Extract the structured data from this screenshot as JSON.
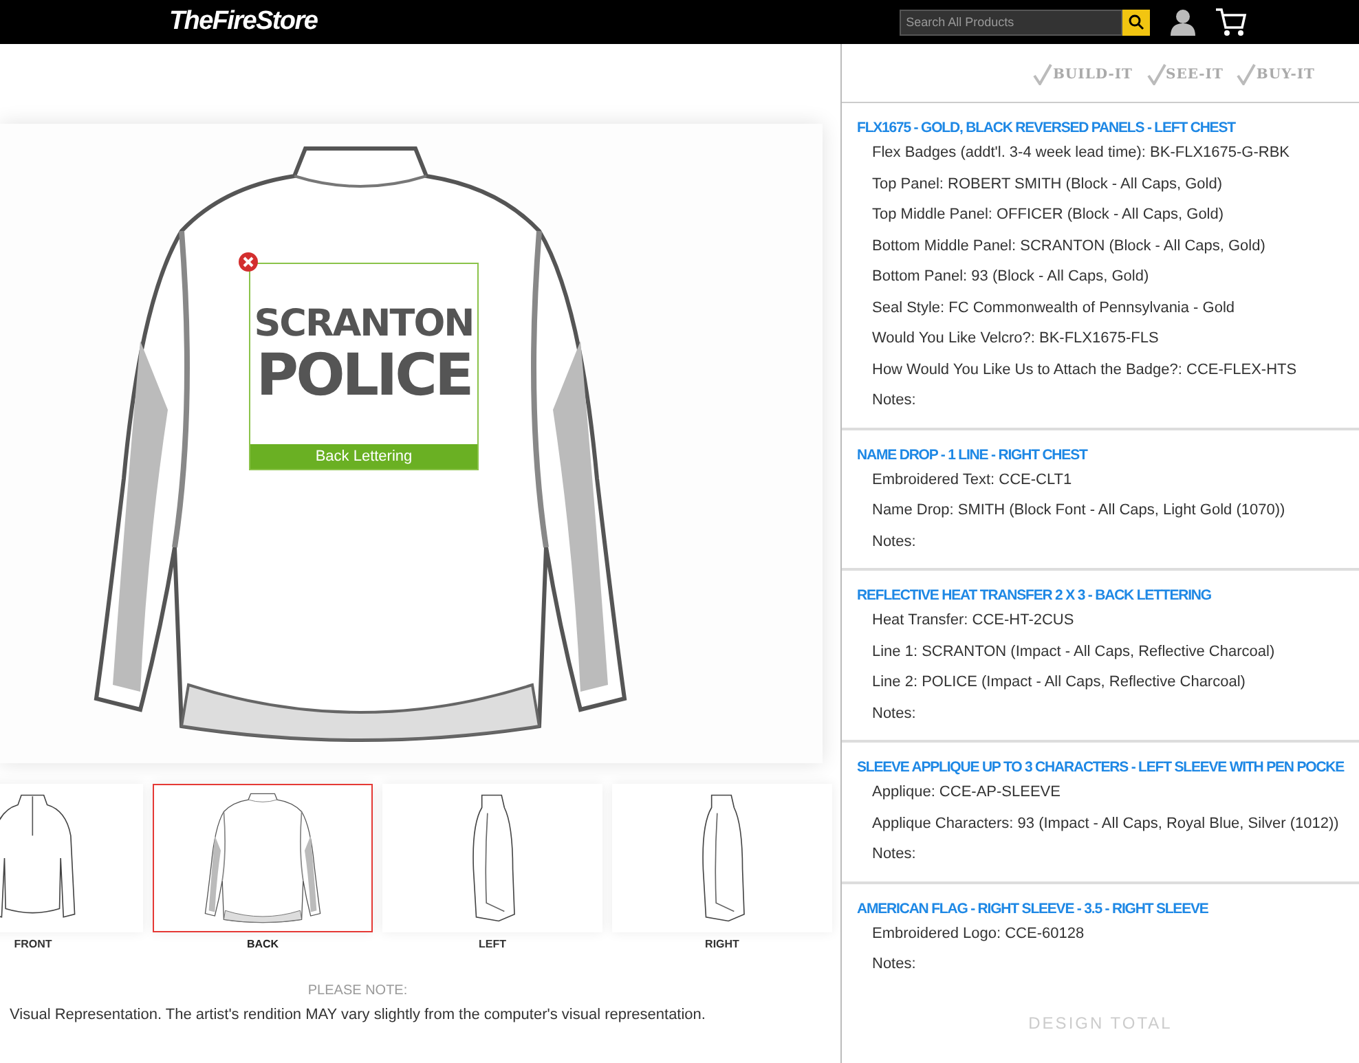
{
  "header": {
    "logo": "TheFireStore",
    "search": {
      "placeholder": "Search All Products"
    }
  },
  "steps": [
    {
      "label": "BUILD-IT"
    },
    {
      "label": "SEE-IT"
    },
    {
      "label": "BUY-IT"
    }
  ],
  "preview": {
    "lettering": {
      "line_1": "SCRANTON",
      "line_2": "POLICE",
      "label": "Back Lettering"
    }
  },
  "views": [
    {
      "label": "FRONT",
      "kind": "front",
      "selected": false
    },
    {
      "label": "BACK",
      "kind": "back",
      "selected": true
    },
    {
      "label": "LEFT",
      "kind": "left",
      "selected": false
    },
    {
      "label": "RIGHT",
      "kind": "right",
      "selected": false
    }
  ],
  "note": {
    "title": "PLEASE NOTE:",
    "text": "Visual Representation. The artist's rendition MAY vary slightly from the computer's visual representation."
  },
  "sections": [
    {
      "title": "FLX1675 - GOLD, BLACK REVERSED PANELS - LEFT CHEST",
      "lines": [
        "Flex Badges (addt'l. 3-4 week lead time): BK-FLX1675-G-RBK",
        "Top Panel: ROBERT SMITH (Block - All Caps, Gold)",
        "Top Middle Panel: OFFICER (Block - All Caps, Gold)",
        "Bottom Middle Panel: SCRANTON (Block - All Caps, Gold)",
        "Bottom Panel: 93 (Block - All Caps, Gold)",
        "Seal Style: FC Commonwealth of Pennsylvania - Gold",
        "Would You Like Velcro?: BK-FLX1675-FLS",
        "How Would You Like Us to Attach the Badge?: CCE-FLEX-HTS",
        "Notes:"
      ]
    },
    {
      "title": "NAME DROP - 1 LINE - RIGHT CHEST",
      "lines": [
        "Embroidered Text: CCE-CLT1",
        "Name Drop: SMITH (Block Font - All Caps, Light Gold (1070))",
        "Notes:"
      ]
    },
    {
      "title": "REFLECTIVE HEAT TRANSFER 2 X 3 - BACK LETTERING",
      "lines": [
        "Heat Transfer: CCE-HT-2CUS",
        "Line 1: SCRANTON (Impact - All Caps, Reflective Charcoal)",
        "Line 2: POLICE (Impact - All Caps, Reflective Charcoal)",
        "Notes:"
      ]
    },
    {
      "title": "SLEEVE APPLIQUE UP TO 3 CHARACTERS - LEFT SLEEVE WITH PEN POCKE",
      "lines": [
        "Applique: CCE-AP-SLEEVE",
        "Applique Characters: 93 (Impact - All Caps, Royal Blue, Silver (1012))",
        "Notes:"
      ]
    },
    {
      "title": "AMERICAN FLAG - RIGHT SLEEVE - 3.5 - RIGHT SLEEVE",
      "lines": [
        "Embroidered Logo: CCE-60128",
        "Notes:"
      ]
    }
  ],
  "design_total": "DESIGN TOTAL"
}
